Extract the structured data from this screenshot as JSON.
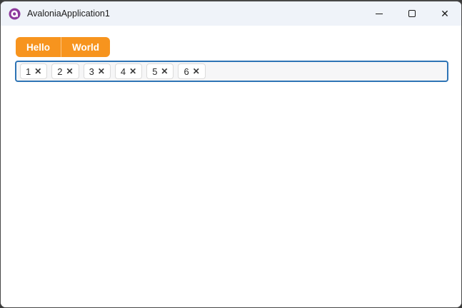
{
  "titlebar": {
    "title": "AvaloniaApplication1",
    "app_icon": "avalonia-logo",
    "controls": {
      "minimize": "minimize-icon",
      "maximize": "maximize-icon",
      "close_glyph": "✕"
    }
  },
  "content": {
    "segmented_button": {
      "segments": [
        "Hello",
        "World"
      ]
    },
    "chip_input": {
      "chips": [
        "1",
        "2",
        "3",
        "4",
        "5",
        "6"
      ],
      "close_glyph": "✕"
    }
  },
  "colors": {
    "accent_orange": "#F7941E",
    "chip_row_border": "#2E74B5",
    "titlebar_bg": "#EFF3F9",
    "window_border": "#474747",
    "logo_purple": "#8E3A9D"
  }
}
